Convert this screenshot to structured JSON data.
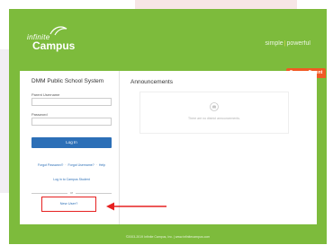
{
  "branding": {
    "logo_line1": "infinite",
    "logo_line2": "Campus",
    "tagline_left": "simple",
    "tagline_pipe": "|",
    "tagline_right": "powerful"
  },
  "portal_tab": "Campus Parent",
  "login": {
    "district": "DMM Public School System",
    "username_label": "Parent Username",
    "username_value": "",
    "password_label": "Password",
    "password_value": "",
    "login_button": "Log In",
    "forgot_password": "Forgot Password?",
    "forgot_username": "Forgot Username?",
    "help": "Help",
    "link_sep": "·",
    "student_login": "Log in to Campus Student",
    "or_text": "or",
    "new_user": "New User?"
  },
  "announcements": {
    "title": "Announcements",
    "empty_text": "There are no district announcements.",
    "icon": "bell-icon"
  },
  "footer": "©2003-2019 Infinite Campus, Inc. | www.infinitecampus.com",
  "colors": {
    "frame": "#7dbb3c",
    "portal_tab": "#f15a24",
    "primary": "#2c6fb7",
    "highlight": "#e62020"
  }
}
